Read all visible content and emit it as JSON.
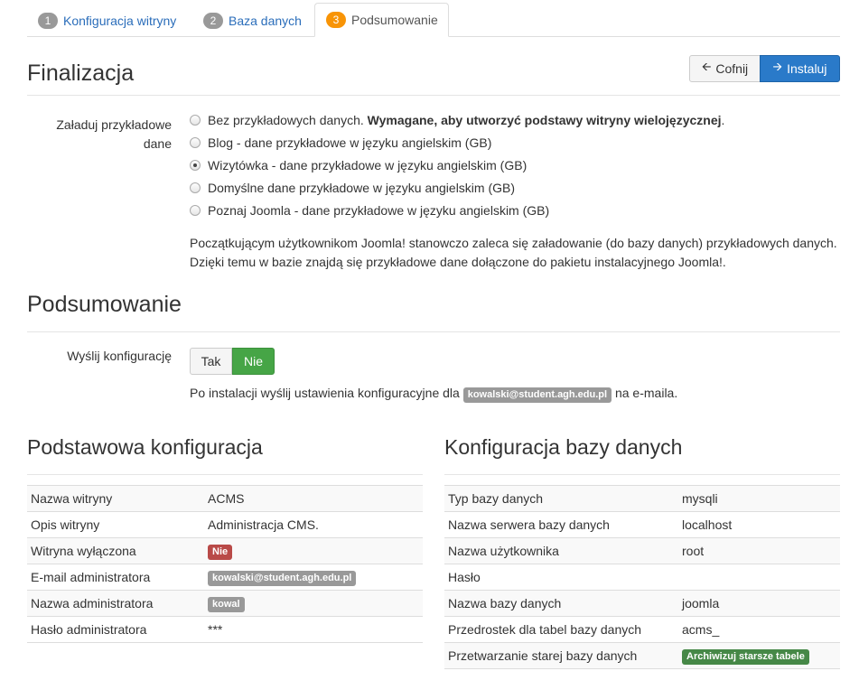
{
  "tabs": [
    {
      "num": "1",
      "label": "Konfiguracja witryny"
    },
    {
      "num": "2",
      "label": "Baza danych"
    },
    {
      "num": "3",
      "label": "Podsumowanie"
    }
  ],
  "finalizacja": {
    "title": "Finalizacja",
    "back_label": "Cofnij",
    "install_label": "Instaluj",
    "sample_label_line1": "Załaduj przykładowe",
    "sample_label_line2": "dane",
    "options": [
      {
        "text": "Bez przykładowych danych.",
        "bold": "Wymagane, aby utworzyć podstawy witryny wielojęzycznej",
        "tail": ".",
        "checked": false
      },
      {
        "text": "Blog - dane przykładowe w języku angielskim (GB)",
        "checked": false
      },
      {
        "text": "Wizytówka - dane przykładowe w języku angielskim (GB)",
        "checked": true
      },
      {
        "text": "Domyślne dane przykładowe w języku angielskim (GB)",
        "checked": false
      },
      {
        "text": "Poznaj Joomla - dane przykładowe w języku angielskim (GB)",
        "checked": false
      }
    ],
    "help_line1": "Początkującym użytkownikom Joomla! stanowczo zaleca się załadowanie (do bazy danych) przykładowych danych.",
    "help_line2": "Dzięki temu w bazie znajdą się przykładowe dane dołączone do pakietu instalacyjnego Joomla!."
  },
  "podsumowanie": {
    "title": "Podsumowanie",
    "send_label": "Wyślij konfigurację",
    "yes": "Tak",
    "no": "Nie",
    "note_before": "Po instalacji wyślij ustawienia konfiguracyjne dla",
    "note_email": "kowalski@student.agh.edu.pl",
    "note_after": "na e-maila."
  },
  "basic_config": {
    "title": "Podstawowa konfiguracja",
    "rows": [
      {
        "label": "Nazwa witryny",
        "value": "ACMS"
      },
      {
        "label": "Opis witryny",
        "value": "Administracja CMS."
      },
      {
        "label": "Witryna wyłączona",
        "value": "Nie"
      },
      {
        "label": "E-mail administratora",
        "value": "kowalski@student.agh.edu.pl"
      },
      {
        "label": "Nazwa administratora",
        "value": "kowal"
      },
      {
        "label": "Hasło administratora",
        "value": "***"
      }
    ]
  },
  "db_config": {
    "title": "Konfiguracja bazy danych",
    "rows": [
      {
        "label": "Typ bazy danych",
        "value": "mysqli"
      },
      {
        "label": "Nazwa serwera bazy danych",
        "value": "localhost"
      },
      {
        "label": "Nazwa użytkownika",
        "value": "root"
      },
      {
        "label": "Hasło",
        "value": ""
      },
      {
        "label": "Nazwa bazy danych",
        "value": "joomla"
      },
      {
        "label": "Przedrostek dla tabel bazy danych",
        "value": "acms_"
      },
      {
        "label": "Przetwarzanie starej bazy danych",
        "value": "Archiwizuj starsze tabele"
      }
    ]
  },
  "colors": {
    "link": "#2a6dba",
    "active_step": "#f89406",
    "primary": "#2a7ac9",
    "success": "#46a546",
    "danger": "#b94a48"
  }
}
